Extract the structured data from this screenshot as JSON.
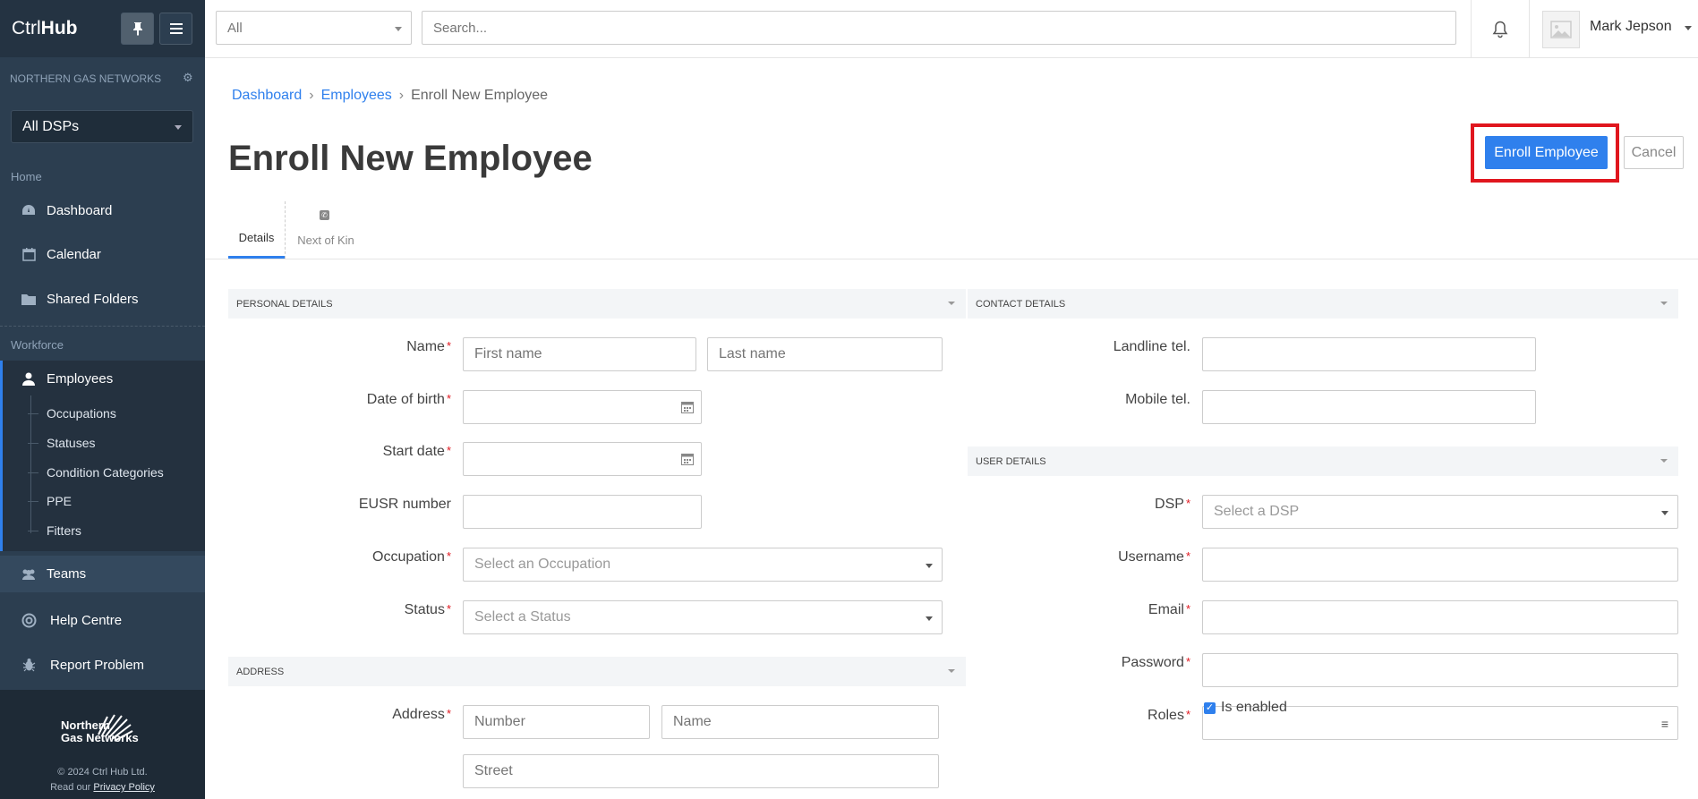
{
  "brand": {
    "prefix": "Ctrl",
    "suffix": "Hub"
  },
  "sidebar": {
    "org": "NORTHERN GAS NETWORKS",
    "dsp_select": "All DSPs",
    "section_home": "Home",
    "section_workforce": "Workforce",
    "items": [
      {
        "label": "Dashboard",
        "icon": "dashboard-icon"
      },
      {
        "label": "Calendar",
        "icon": "calendar-icon"
      },
      {
        "label": "Shared Folders",
        "icon": "folder-icon"
      },
      {
        "label": "Employees",
        "icon": "user-icon"
      },
      {
        "label": "Teams",
        "icon": "users-icon"
      },
      {
        "label": "Help Centre",
        "icon": "lifebuoy-icon"
      },
      {
        "label": "Report Problem",
        "icon": "bug-icon"
      }
    ],
    "sub_items": [
      "Occupations",
      "Statuses",
      "Condition Categories",
      "PPE",
      "Fitters"
    ],
    "footer": {
      "logo_line1": "Northern",
      "logo_line2": "Gas Networks",
      "copyright": "© 2024 Ctrl Hub Ltd.",
      "privacy_prefix": "Read our",
      "privacy_link": "Privacy Policy"
    }
  },
  "topbar": {
    "scope": "All",
    "search_placeholder": "Search...",
    "user_name": "Mark Jepson"
  },
  "breadcrumb": [
    "Dashboard",
    "Employees",
    "Enroll New Employee"
  ],
  "page_title": "Enroll New Employee",
  "actions": {
    "primary": "Enroll Employee",
    "cancel": "Cancel"
  },
  "tabs": [
    "Details",
    "Next of Kin"
  ],
  "personal": {
    "title": "PERSONAL DETAILS",
    "name_label": "Name",
    "first_placeholder": "First name",
    "last_placeholder": "Last name",
    "dob_label": "Date of birth",
    "start_label": "Start date",
    "eusr_label": "EUSR number",
    "occupation_label": "Occupation",
    "occupation_placeholder": "Select an Occupation",
    "status_label": "Status",
    "status_placeholder": "Select a Status"
  },
  "address": {
    "title": "ADDRESS",
    "label": "Address",
    "number_placeholder": "Number",
    "name_placeholder": "Name",
    "street_placeholder": "Street"
  },
  "contact": {
    "title": "CONTACT DETAILS",
    "landline_label": "Landline tel.",
    "mobile_label": "Mobile tel."
  },
  "user": {
    "title": "USER DETAILS",
    "dsp_label": "DSP",
    "dsp_placeholder": "Select a DSP",
    "username_label": "Username",
    "email_label": "Email",
    "password_label": "Password",
    "roles_label": "Roles",
    "enabled_label": "Is enabled"
  },
  "colors": {
    "accent": "#2f80ed",
    "sidebar": "#2c3e50",
    "highlight": "#e0161e"
  }
}
